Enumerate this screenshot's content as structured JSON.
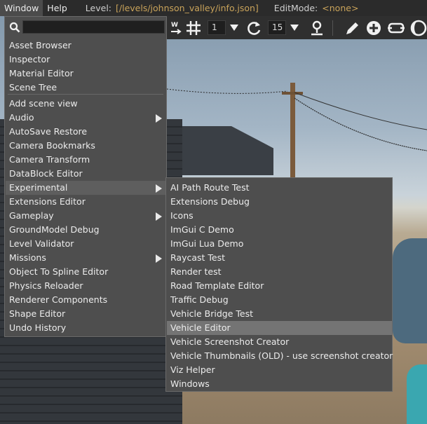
{
  "menubar": {
    "window": "Window",
    "help": "Help",
    "level_label": "Level:",
    "level_value": "[/levels/johnson_valley/info.json]",
    "editmode_label": "EditMode:",
    "editmode_value": "<none>"
  },
  "toolbar": {
    "snap_value": "1",
    "rotate_value": "15",
    "icons": [
      "world-snap-icon",
      "grid-icon",
      "dropdown-icon",
      "rotate-icon",
      "terrain-snap-icon",
      "pencil-icon",
      "add-circle-icon",
      "shape-icon",
      "moon-icon"
    ]
  },
  "window_menu": {
    "search_placeholder": "",
    "group1": [
      {
        "label": "Asset Browser"
      },
      {
        "label": "Inspector"
      },
      {
        "label": "Material Editor"
      },
      {
        "label": "Scene Tree"
      }
    ],
    "group2": [
      {
        "label": "Add scene view"
      },
      {
        "label": "Audio",
        "submenu": true
      },
      {
        "label": "AutoSave Restore"
      },
      {
        "label": "Camera Bookmarks"
      },
      {
        "label": "Camera Transform"
      },
      {
        "label": "DataBlock Editor"
      },
      {
        "label": "Experimental",
        "submenu": true,
        "active": true
      },
      {
        "label": "Extensions Editor"
      },
      {
        "label": "Gameplay",
        "submenu": true
      },
      {
        "label": "GroundModel Debug"
      },
      {
        "label": "Level Validator"
      },
      {
        "label": "Missions",
        "submenu": true
      },
      {
        "label": "Object To Spline Editor"
      },
      {
        "label": "Physics Reloader"
      },
      {
        "label": "Renderer Components"
      },
      {
        "label": "Shape Editor"
      },
      {
        "label": "Undo History"
      }
    ]
  },
  "experimental_menu": {
    "items": [
      {
        "label": "AI Path Route Test"
      },
      {
        "label": "Extensions Debug"
      },
      {
        "label": "Icons"
      },
      {
        "label": "ImGui C Demo"
      },
      {
        "label": "ImGui Lua Demo"
      },
      {
        "label": "Raycast Test"
      },
      {
        "label": "Render test"
      },
      {
        "label": "Road Template Editor"
      },
      {
        "label": "Traffic Debug"
      },
      {
        "label": "Vehicle Bridge Test"
      },
      {
        "label": "Vehicle Editor",
        "active": true
      },
      {
        "label": "Vehicle Screenshot Creator"
      },
      {
        "label": "Vehicle Thumbnails (OLD) - use screenshot creator"
      },
      {
        "label": "Viz Helper"
      },
      {
        "label": "Windows"
      }
    ]
  },
  "colors": {
    "menu_bg": "#4e4e4e",
    "menubar_bg": "#2b2b2b",
    "highlight": "#747474",
    "accent_text": "#c9a35a"
  }
}
